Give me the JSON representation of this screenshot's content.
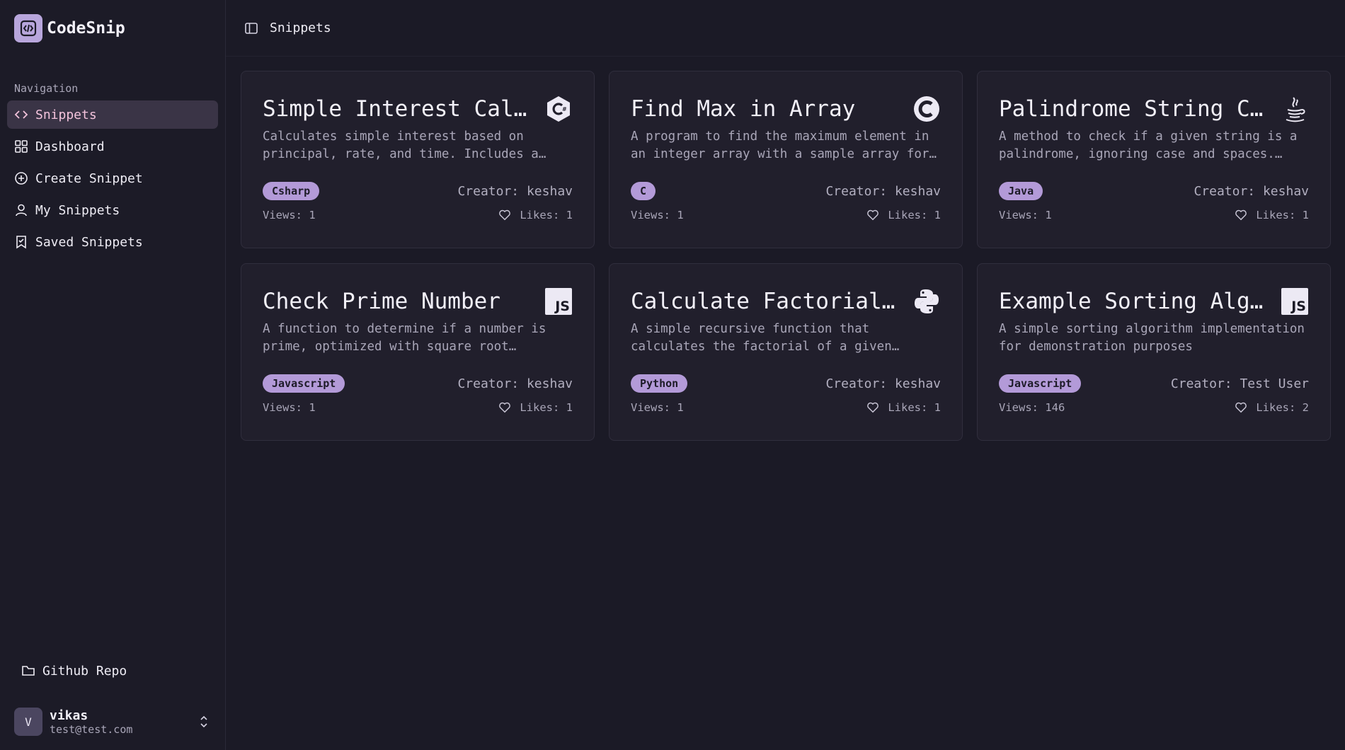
{
  "app": {
    "name": "CodeSnip"
  },
  "sidebar": {
    "section_heading": "Navigation",
    "items": [
      {
        "label": "Snippets",
        "icon": "code-icon",
        "active": true
      },
      {
        "label": "Dashboard",
        "icon": "grid-icon",
        "active": false
      },
      {
        "label": "Create Snippet",
        "icon": "plus-circle-icon",
        "active": false
      },
      {
        "label": "My Snippets",
        "icon": "user-icon",
        "active": false
      },
      {
        "label": "Saved Snippets",
        "icon": "bookmark-icon",
        "active": false
      }
    ],
    "repo_link": "Github Repo",
    "user": {
      "initial": "V",
      "name": "vikas",
      "email": "test@test.com"
    }
  },
  "header": {
    "title": "Snippets",
    "toggle_icon": "sidebar-toggle-icon"
  },
  "snippets": [
    {
      "title": "Simple Interest Calculator in C#",
      "description": "Calculates simple interest based on principal, rate, and time. Includes a sample calculation.",
      "language": "Csharp",
      "creator_label": "Creator: keshav",
      "views_label": "Views: 1",
      "likes_label": "Likes: 1",
      "icon": "csharp-icon"
    },
    {
      "title": "Find Max in Array",
      "description": "A program to find the maximum element in an integer array with a sample array for testing.",
      "language": "C",
      "creator_label": "Creator: keshav",
      "views_label": "Views: 1",
      "likes_label": "Likes: 1",
      "icon": "c-icon"
    },
    {
      "title": "Palindrome String Checker",
      "description": "A method to check if a given string is a palindrome, ignoring case and spaces. Includes examples.",
      "language": "Java",
      "creator_label": "Creator: keshav",
      "views_label": "Views: 1",
      "likes_label": "Likes: 1",
      "icon": "java-icon"
    },
    {
      "title": "Check Prime Number",
      "description": "A function to determine if a number is prime, optimized with square root checking.",
      "language": "Javascript",
      "creator_label": "Creator: keshav",
      "views_label": "Views: 1",
      "likes_label": "Likes: 1",
      "icon": "javascript-icon"
    },
    {
      "title": "Calculate Factorial Using Recursion",
      "description": "A simple recursive function that calculates the factorial of a given number.",
      "language": "Python",
      "creator_label": "Creator: keshav",
      "views_label": "Views: 1",
      "likes_label": "Likes: 1",
      "icon": "python-icon"
    },
    {
      "title": "Example Sorting Algorithm",
      "description": "A simple sorting algorithm implementation for demonstration purposes",
      "language": "Javascript",
      "creator_label": "Creator: Test User",
      "views_label": "Views: 146",
      "likes_label": "Likes: 2",
      "icon": "javascript-icon"
    }
  ],
  "colors": {
    "background": "#1b1a26",
    "card": "#211f2c",
    "accent_tag": "#b39ad8",
    "active_nav_bg": "#3a3446",
    "active_nav_text": "#f3c3dc",
    "logo": "#b8a6dc"
  }
}
